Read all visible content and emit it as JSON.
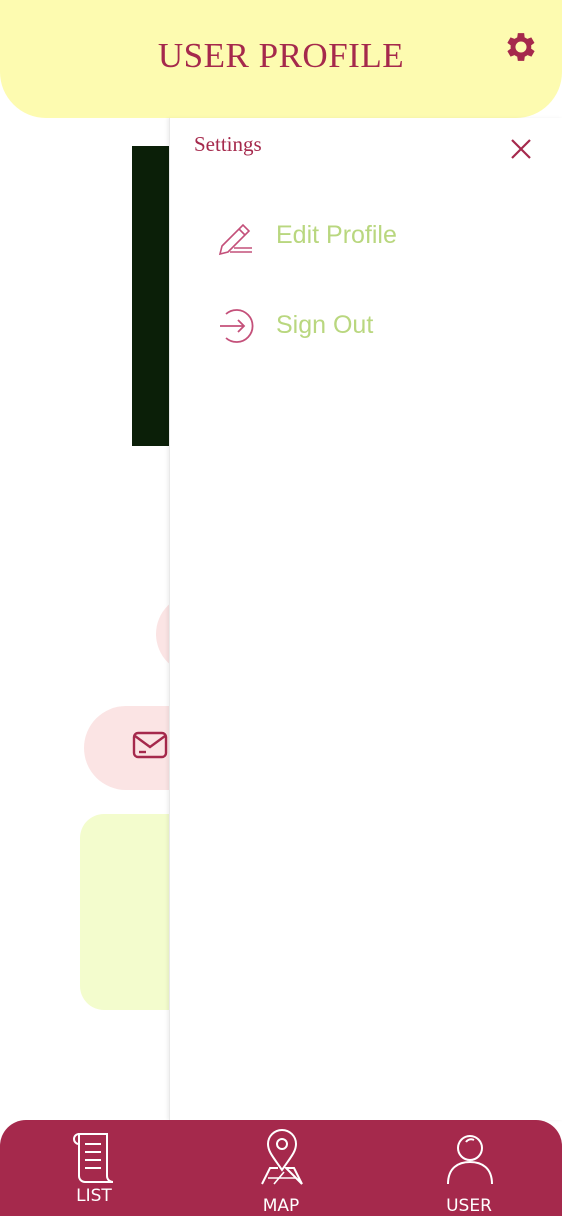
{
  "header": {
    "title": "USER PROFILE"
  },
  "settings_drawer": {
    "title": "Settings",
    "items": [
      {
        "label": "Edit Profile",
        "icon": "pencil-icon"
      },
      {
        "label": "Sign Out",
        "icon": "sign-out-icon"
      }
    ]
  },
  "bottom_nav": {
    "items": [
      {
        "label": "LIST",
        "icon": "scroll-list-icon"
      },
      {
        "label": "MAP",
        "icon": "map-pin-icon"
      },
      {
        "label": "USER",
        "icon": "user-icon"
      }
    ]
  },
  "colors": {
    "header_bg": "#fdfbb0",
    "accent": "#a5294c",
    "menu_label": "#b9d77f",
    "email_pill": "#fbe4e4",
    "info_card": "#f3fccd"
  }
}
